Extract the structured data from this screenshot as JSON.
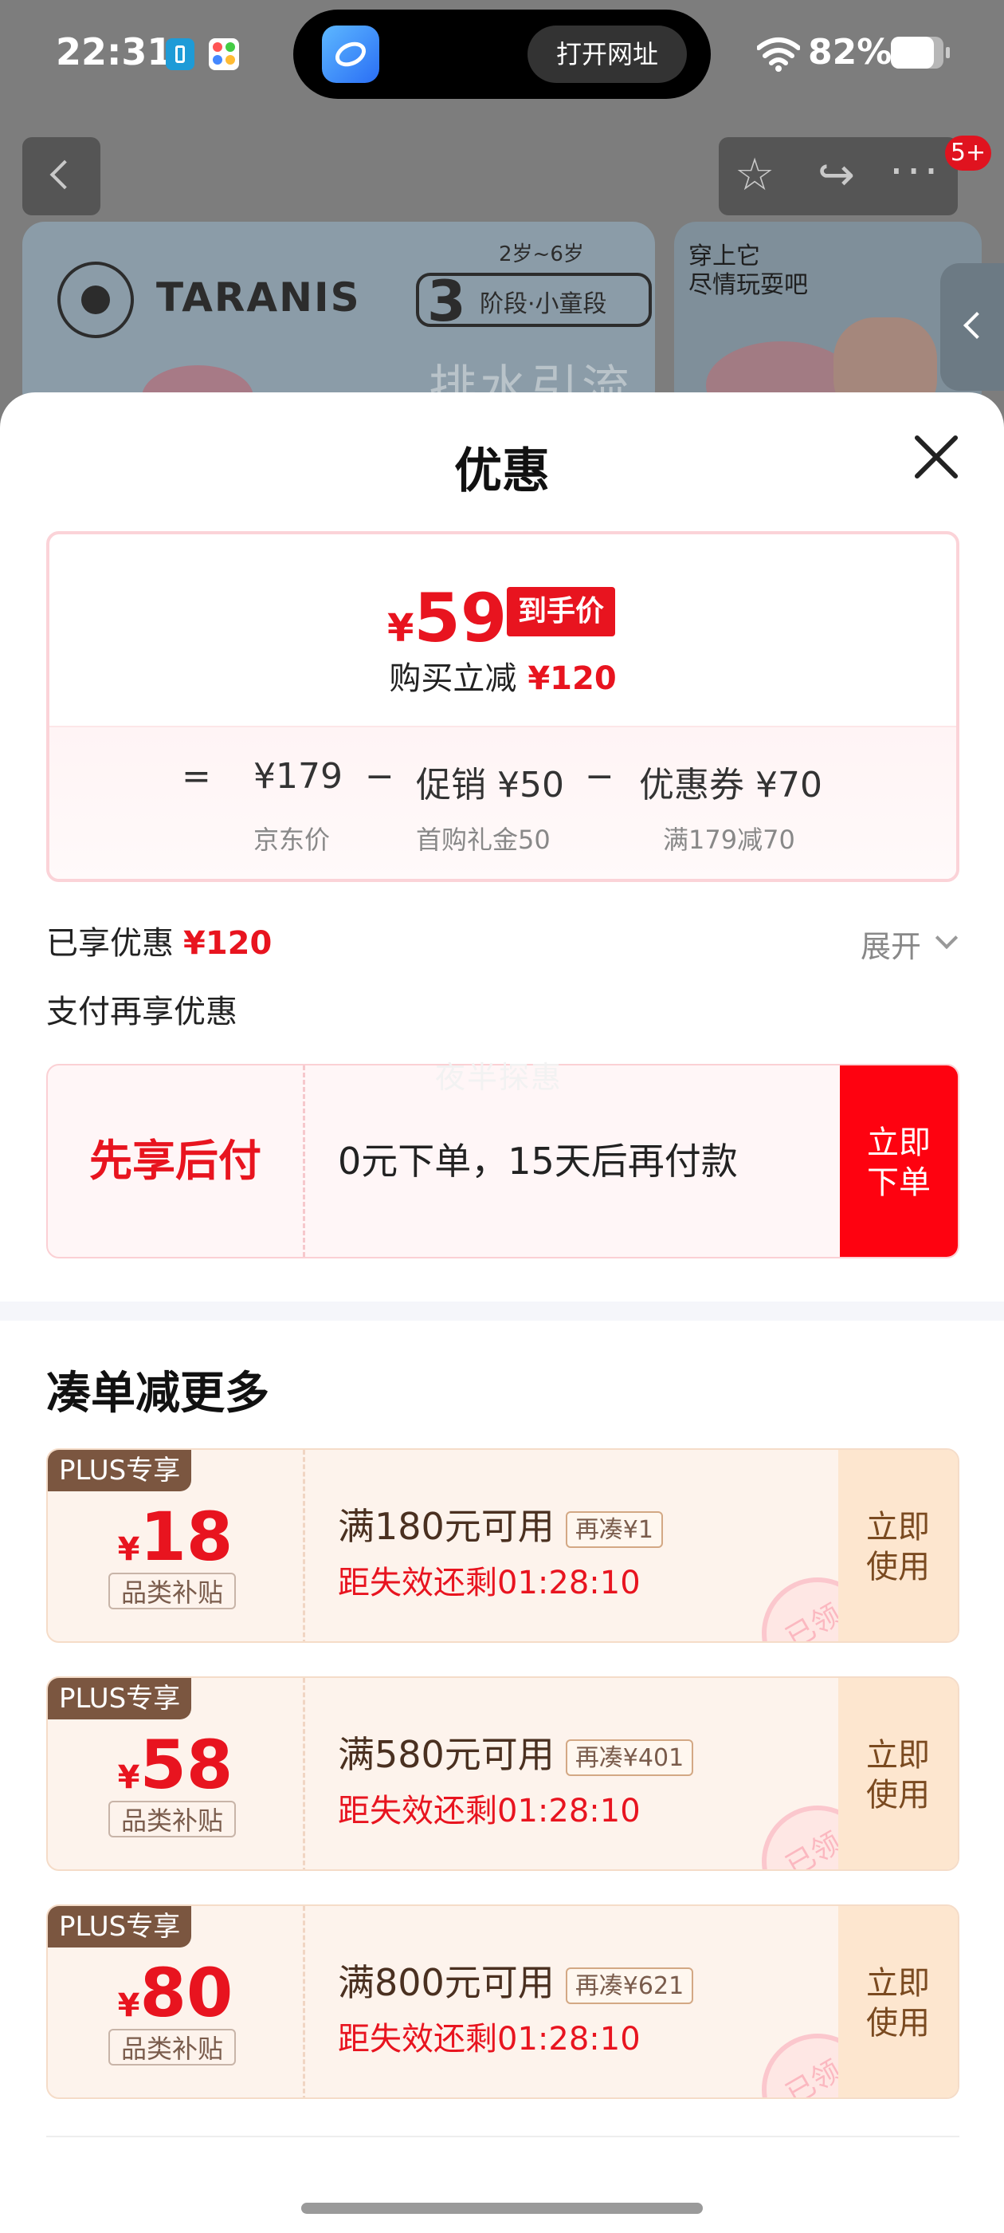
{
  "status_bar": {
    "time": "22:31",
    "battery": "82%",
    "battery_level": 0.82
  },
  "dynamic_island": {
    "action_label": "打开网址"
  },
  "background_page": {
    "badge": "5+",
    "brand": "TARANIS",
    "stage_number": "3",
    "stage_age": "2岁~6岁",
    "stage_label": "阶段·小童段",
    "slogan": "排水引流",
    "card2_text": "穿上它\n尽情玩耍吧"
  },
  "sheet": {
    "title": "优惠",
    "price_card": {
      "currency": "¥",
      "final_price": "59",
      "final_tag": "到手价",
      "reduce_label": "购买立减",
      "reduce_amount": "¥120",
      "formula": {
        "equals": "=",
        "minus": "−",
        "jd_price": "¥179",
        "jd_price_label": "京东价",
        "promo": "促销 ¥50",
        "promo_label": "首购礼金50",
        "coupon": "优惠券 ¥70",
        "coupon_label": "满179减70"
      }
    },
    "enjoyed_label": "已享优惠",
    "enjoyed_amount": "¥120",
    "expand_label": "展开",
    "pay_more_label": "支付再享优惠",
    "watermark": "夜半探惠",
    "bnpl": {
      "name": "先享后付",
      "desc": "0元下单，15天后再付款",
      "button": "立即下单"
    },
    "section_title": "凑单减更多",
    "coupons": [
      {
        "plus_tag": "PLUS专享",
        "currency": "¥",
        "amount": "18",
        "category": "品类补贴",
        "condition": "满180元可用",
        "gap": "再凑¥1",
        "timer": "距失效还剩01:28:10",
        "stamp": "已领",
        "button": "立即使用"
      },
      {
        "plus_tag": "PLUS专享",
        "currency": "¥",
        "amount": "58",
        "category": "品类补贴",
        "condition": "满580元可用",
        "gap": "再凑¥401",
        "timer": "距失效还剩01:28:10",
        "stamp": "已领",
        "button": "立即使用"
      },
      {
        "plus_tag": "PLUS专享",
        "currency": "¥",
        "amount": "80",
        "category": "品类补贴",
        "condition": "满800元可用",
        "gap": "再凑¥621",
        "timer": "距失效还剩01:28:10",
        "stamp": "已领",
        "button": "立即使用"
      }
    ]
  },
  "colors": {
    "accent_red": "#e8141f",
    "plus_brown": "#7b5640",
    "coupon_bg": "#fdf3ec"
  }
}
